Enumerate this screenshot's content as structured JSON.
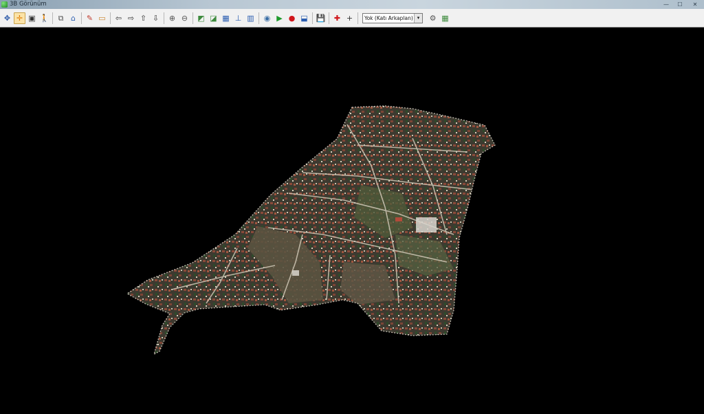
{
  "window": {
    "title": "3B Görünüm",
    "controls": {
      "minimize": "—",
      "maximize": "☐",
      "close": "✕"
    }
  },
  "toolbar": {
    "buttons": [
      {
        "icon": "pan-icon",
        "glyph": "✥",
        "color": "#2c59a8"
      },
      {
        "icon": "move-icon",
        "glyph": "✛",
        "color": "#e07b00",
        "active": true
      },
      {
        "icon": "layer-icon",
        "glyph": "▣",
        "color": "#333"
      },
      {
        "icon": "walk-icon",
        "glyph": "🚶",
        "color": "#1f3f9a"
      },
      {
        "icon": "copy-icon",
        "glyph": "⧉",
        "color": "#555"
      },
      {
        "icon": "home-icon",
        "glyph": "⌂",
        "color": "#2a5db0"
      },
      {
        "icon": "measure-icon",
        "glyph": "✎",
        "color": "#c0392b"
      },
      {
        "icon": "ruler-icon",
        "glyph": "▭",
        "color": "#c9822b"
      },
      {
        "icon": "arrow-left-icon",
        "glyph": "⇦",
        "color": "#333"
      },
      {
        "icon": "arrow-right-icon",
        "glyph": "⇨",
        "color": "#333"
      },
      {
        "icon": "arrow-up-icon",
        "glyph": "⇧",
        "color": "#333"
      },
      {
        "icon": "arrow-down-icon",
        "glyph": "⇩",
        "color": "#333"
      },
      {
        "icon": "zoom-in-icon",
        "glyph": "⊕",
        "color": "#555"
      },
      {
        "icon": "zoom-out-icon",
        "glyph": "⊖",
        "color": "#555"
      },
      {
        "icon": "terrain-icon",
        "glyph": "◩",
        "color": "#3d8a3d"
      },
      {
        "icon": "terrain-edit-icon",
        "glyph": "◪",
        "color": "#3d8a3d"
      },
      {
        "icon": "texture-icon",
        "glyph": "▦",
        "color": "#2a5db0"
      },
      {
        "icon": "elevation-icon",
        "glyph": "⊥",
        "color": "#2a5db0"
      },
      {
        "icon": "chart-icon",
        "glyph": "▥",
        "color": "#2a5db0"
      },
      {
        "icon": "camera-icon",
        "glyph": "◉",
        "color": "#3a6ea5"
      },
      {
        "icon": "play-icon",
        "glyph": "▶",
        "color": "#1e9a2c"
      },
      {
        "icon": "record-icon",
        "glyph": "●",
        "color": "#d0161b"
      },
      {
        "icon": "export-icon",
        "glyph": "⬓",
        "color": "#2a5db0"
      },
      {
        "icon": "save-icon",
        "glyph": "💾",
        "color": "#1e2a8a"
      },
      {
        "icon": "crosshair-red-icon",
        "glyph": "✚",
        "color": "#d0161b"
      },
      {
        "icon": "crosshair-icon",
        "glyph": "+",
        "color": "#333"
      }
    ],
    "background_select": {
      "value": "Yok (Katı Arkaplan)",
      "arrow": "▾"
    },
    "extra_buttons": [
      {
        "icon": "settings-icon",
        "glyph": "⚙",
        "color": "#555"
      },
      {
        "icon": "grid-icon",
        "glyph": "▦",
        "color": "#3d8a3d"
      }
    ]
  },
  "colors": {
    "viewport_background": "#000000",
    "terrain_base": "#4a3f2f",
    "roads": "#cfc7b6"
  }
}
